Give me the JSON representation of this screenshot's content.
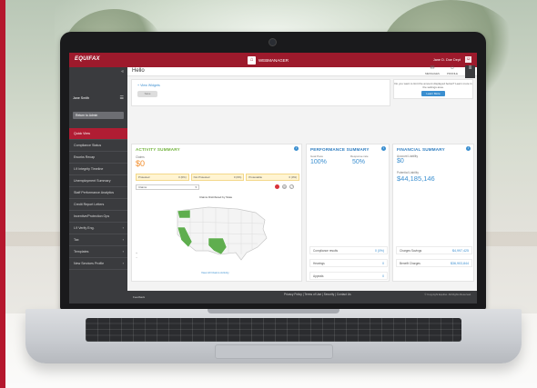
{
  "app": {
    "brand": "EQUIFAX",
    "product": "WEBMANAGER",
    "product_icon": "home-icon",
    "user_label": "Jane D. Doe Dept",
    "accent_color": "#9d1a2c"
  },
  "sidebar": {
    "collapse_glyph": "«",
    "user": "Jane Smith",
    "return_label": "Return to Admin",
    "items": [
      {
        "label": "Quick View",
        "active": true
      },
      {
        "label": "Compliance Status"
      },
      {
        "label": "Eworks Recap"
      },
      {
        "label": "I-9 Integrity Timeline"
      },
      {
        "label": "Unemployment Summary"
      },
      {
        "label": "Staff Performance Analytics"
      },
      {
        "label": "Credit Report Letters"
      },
      {
        "label": "Incentive/Protection Ops"
      },
      {
        "label": "I-9 Verify Eng.",
        "chevron": true
      },
      {
        "label": "Tax",
        "chevron": true
      },
      {
        "label": "Templates",
        "chevron": true
      },
      {
        "label": "New Services Profile",
        "chevron": true
      }
    ]
  },
  "header": {
    "title": "Hello",
    "icons": [
      {
        "name": "messages-icon",
        "glyph": "✉",
        "label": "MESSAGES"
      },
      {
        "name": "profile-icon",
        "glyph": "☺",
        "label": "PROFILE"
      },
      {
        "name": "more-icon",
        "glyph": "≡",
        "label": ""
      }
    ]
  },
  "widgets": {
    "link": "+ View Widgets",
    "button": "Save"
  },
  "notice": {
    "text": "Do you want to limit the amount displayed below? Learn more in the settings area.",
    "button": "Learn More"
  },
  "activity": {
    "title": "ACTIVITY SUMMARY",
    "label": "Claims",
    "value": "$0",
    "chips": [
      {
        "label": "Protested",
        "value": "0 (0%)"
      },
      {
        "label": "Not Protested",
        "value": "0 (0%)"
      },
      {
        "label": "Protestable",
        "value": "0 (0%)"
      }
    ],
    "select": "Claims",
    "map_caption": "Claims Distributed by State",
    "map_link": "View All Claims Activity",
    "highlight_color": "#5fae4e"
  },
  "performance": {
    "title": "PERFORMANCE SUMMARY",
    "col1_label": "Goal Pace",
    "col1_value": "100%",
    "col2_label": "Response rate",
    "col2_value": "50%",
    "rows": [
      {
        "label": "Compliance results",
        "value": "0 (0%)"
      },
      {
        "label": "Hearings",
        "value": "0"
      },
      {
        "label": "Appeals",
        "value": "0"
      }
    ]
  },
  "financial": {
    "title": "FINANCIAL SUMMARY",
    "label1": "Account Liability",
    "value1": "$0",
    "label2": "Potential Liability",
    "value2": "$44,185,146",
    "rows": [
      {
        "label": "Charges Savings",
        "value": "$4,997,425"
      },
      {
        "label": "Benefit Charges",
        "value": "$36,903,844"
      }
    ]
  },
  "footer": {
    "left": "Feedback",
    "links": "Privacy Policy | Terms of Use | Security | Contact Us",
    "right": "© Copyright Equifax. All Rights Reserved."
  }
}
